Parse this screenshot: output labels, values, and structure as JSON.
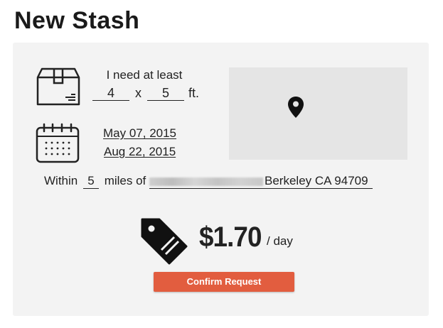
{
  "page": {
    "title": "New Stash"
  },
  "size": {
    "intro": "I need at least",
    "width": "4",
    "times": "x",
    "length": "5",
    "unit": "ft."
  },
  "dates": {
    "start": "May 07, 2015",
    "end": "Aug 22, 2015"
  },
  "location": {
    "prefix": "Within",
    "miles": "5",
    "miles_label": "miles of",
    "address_visible": "Berkeley CA 94709"
  },
  "pricing": {
    "price": "$1.70",
    "period": "/ day"
  },
  "actions": {
    "confirm_label": "Confirm Request"
  },
  "colors": {
    "accent": "#e25d3f",
    "panel": "#f3f3f3",
    "map": "#e5e5e5"
  },
  "icons": [
    "box-icon",
    "calendar-icon",
    "map-pin-icon",
    "price-tag-icon"
  ]
}
